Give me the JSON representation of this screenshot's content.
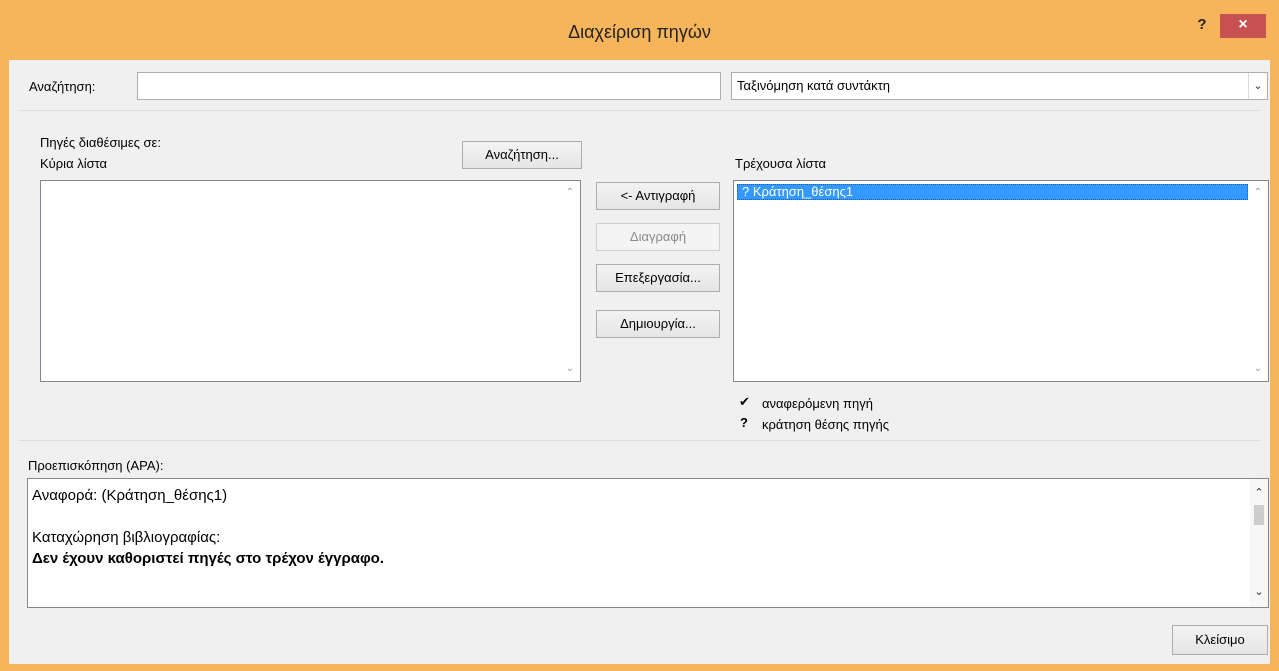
{
  "window": {
    "title": "Διαχείριση πηγών",
    "help": "?",
    "close": "×"
  },
  "search": {
    "label": "Αναζήτηση:",
    "value": ""
  },
  "sort": {
    "selected": "Ταξινόμηση κατά συντάκτη"
  },
  "sources": {
    "available_label": "Πηγές διαθέσιμες σε:",
    "master_label": "Κύρια λίστα",
    "browse_button": "Αναζήτηση...",
    "current_label": "Τρέχουσα λίστα",
    "current_items": [
      {
        "marker": "?",
        "name": "Κράτηση_θέσης1"
      }
    ]
  },
  "actions": {
    "copy": "<- Αντιγραφή",
    "delete": "Διαγραφή",
    "edit": "Επεξεργασία...",
    "new": "Δημιουργία..."
  },
  "legend": {
    "cited_glyph": "✔",
    "cited_label": "αναφερόμενη πηγή",
    "placeholder_glyph": "?",
    "placeholder_label": "κράτηση θέσης πηγής"
  },
  "preview": {
    "label": "Προεπισκόπηση (APA):",
    "citation": "Αναφορά:  (Κράτηση_θέσης1)",
    "bib_label": "Καταχώρηση βιβλιογραφίας:",
    "bib_text": "Δεν έχουν καθοριστεί πηγές στο τρέχον έγγραφο."
  },
  "footer": {
    "close": "Κλείσιμο"
  }
}
